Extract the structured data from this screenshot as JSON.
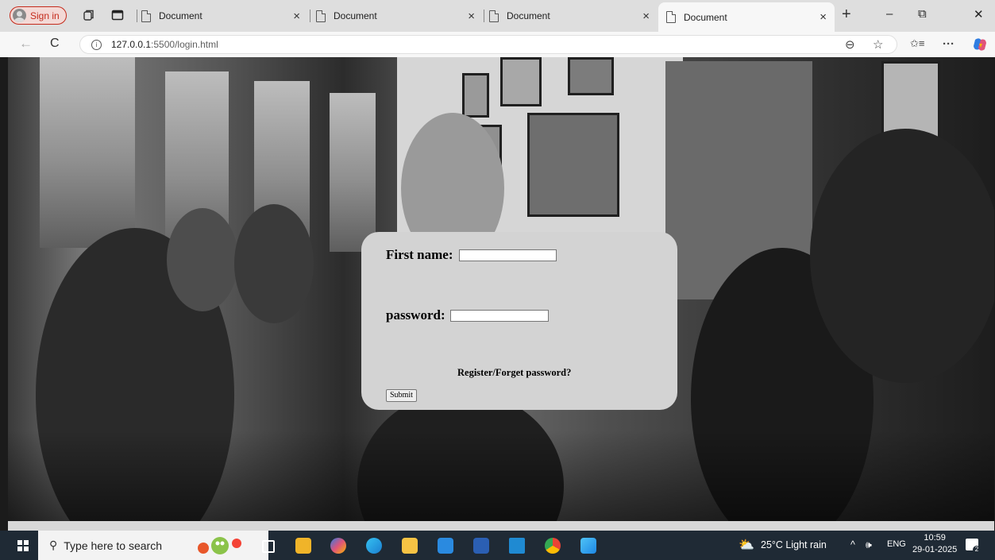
{
  "browser": {
    "signin_label": "Sign in",
    "tabs": [
      {
        "title": "Document",
        "close": "×"
      },
      {
        "title": "Document",
        "close": "×"
      },
      {
        "title": "Document",
        "close": "×"
      },
      {
        "title": "Document",
        "close": "×"
      }
    ],
    "new_tab": "+",
    "window_controls": {
      "minimize": "–",
      "restore": "⧉",
      "close": "✕"
    },
    "nav": {
      "back": "←",
      "reload": "C"
    },
    "url_host": "127.0.0.1",
    "url_path": ":5500/login.html",
    "right_icons": {
      "zoom": "⊖",
      "favorite": "☆",
      "favorites_bar": "⭐",
      "more": "···"
    }
  },
  "form": {
    "first_name_label": "First name:",
    "first_name_value": "",
    "password_label": "password:",
    "password_value": "",
    "register_link": "Register/Forget password?",
    "submit_label": "Submit"
  },
  "taskbar": {
    "search_placeholder": "Type here to search",
    "weather": "25°C  Light rain",
    "tray_arrow": "^",
    "volume": "🕪",
    "language": "ENG",
    "time": "10:59",
    "date": "29-01-2025",
    "notifications": "2",
    "app_icons": [
      "task-view-icon",
      "store-icon",
      "copilot-icon",
      "edge-icon",
      "file-explorer-icon",
      "mail-icon",
      "word-icon",
      "vscode-icon",
      "chrome-icon",
      "photos-icon"
    ]
  }
}
